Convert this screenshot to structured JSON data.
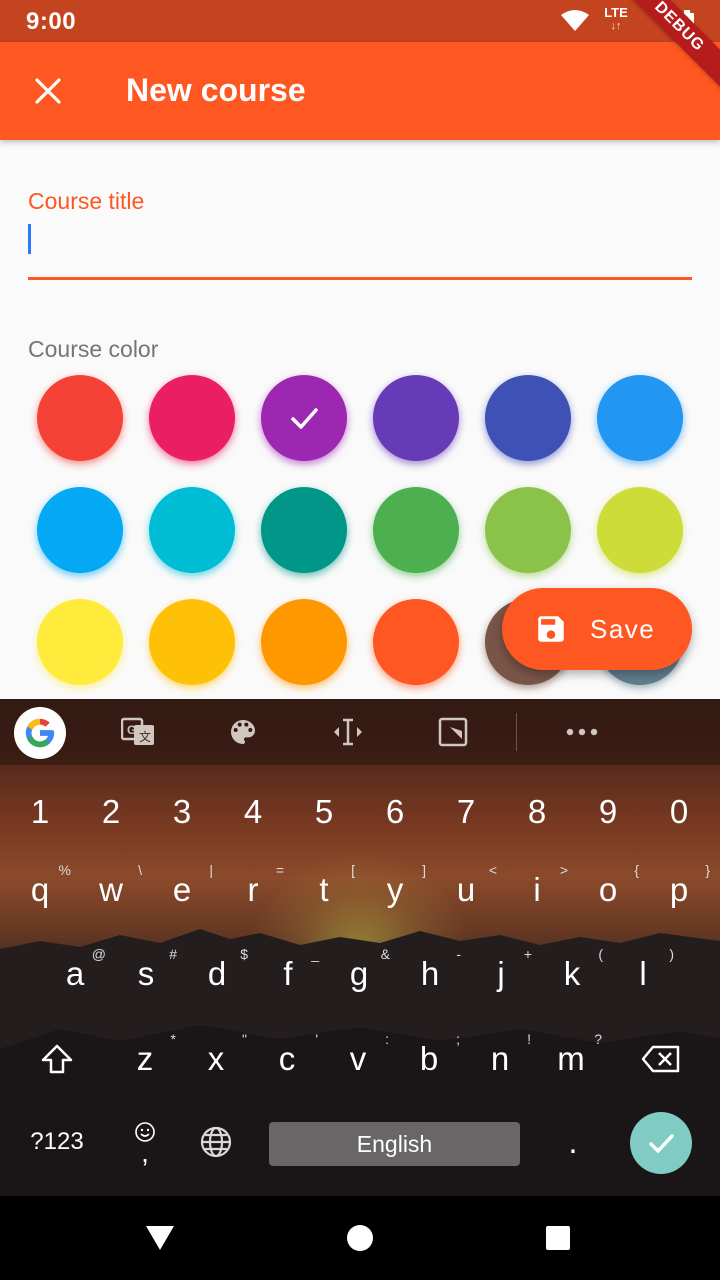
{
  "status_bar": {
    "time": "9:00",
    "network": "LTE",
    "debug_banner": "DEBUG"
  },
  "app_bar": {
    "title": "New course",
    "close_icon": "close-icon"
  },
  "form": {
    "title_label": "Course title",
    "title_value": "",
    "color_label": "Course color",
    "selected_color_index": 2,
    "colors": [
      "#f44336",
      "#e91e63",
      "#9c27b0",
      "#673ab7",
      "#3f51b5",
      "#2196f3",
      "#03a9f4",
      "#00bcd4",
      "#009688",
      "#4caf50",
      "#8bc34a",
      "#cddc39",
      "#ffeb3b",
      "#ffc107",
      "#ff9800",
      "#ff5722",
      "#795548",
      "#607d8b"
    ]
  },
  "fab": {
    "label": "Save",
    "icon": "save-icon"
  },
  "keyboard": {
    "toolbar_icons": [
      "google-icon",
      "translate-icon",
      "palette-icon",
      "text-cursor-icon",
      "screenshot-icon",
      "more-icon"
    ],
    "row_numbers": [
      "1",
      "2",
      "3",
      "4",
      "5",
      "6",
      "7",
      "8",
      "9",
      "0"
    ],
    "row1": [
      "q",
      "w",
      "e",
      "r",
      "t",
      "y",
      "u",
      "i",
      "o",
      "p"
    ],
    "row1_hints": [
      "%",
      "\\",
      "|",
      "=",
      "[",
      "]",
      "<",
      ">",
      "{",
      "}"
    ],
    "row2": [
      "a",
      "s",
      "d",
      "f",
      "g",
      "h",
      "j",
      "k",
      "l"
    ],
    "row2_hints": [
      "@",
      "#",
      "$",
      "_",
      "&",
      "-",
      "+",
      "(",
      ")"
    ],
    "row3": [
      "z",
      "x",
      "c",
      "v",
      "b",
      "n",
      "m"
    ],
    "row3_hints": [
      "*",
      "\"",
      "'",
      ":",
      ";",
      "!",
      "?"
    ],
    "symbols_key": "?123",
    "emoji_key": ",",
    "space_label": "English",
    "period_key": "."
  },
  "colors": {
    "primary": "#ff5722",
    "status_bar": "#c4441f",
    "accent_enter": "#80cbc4",
    "cursor": "#2979ff"
  }
}
